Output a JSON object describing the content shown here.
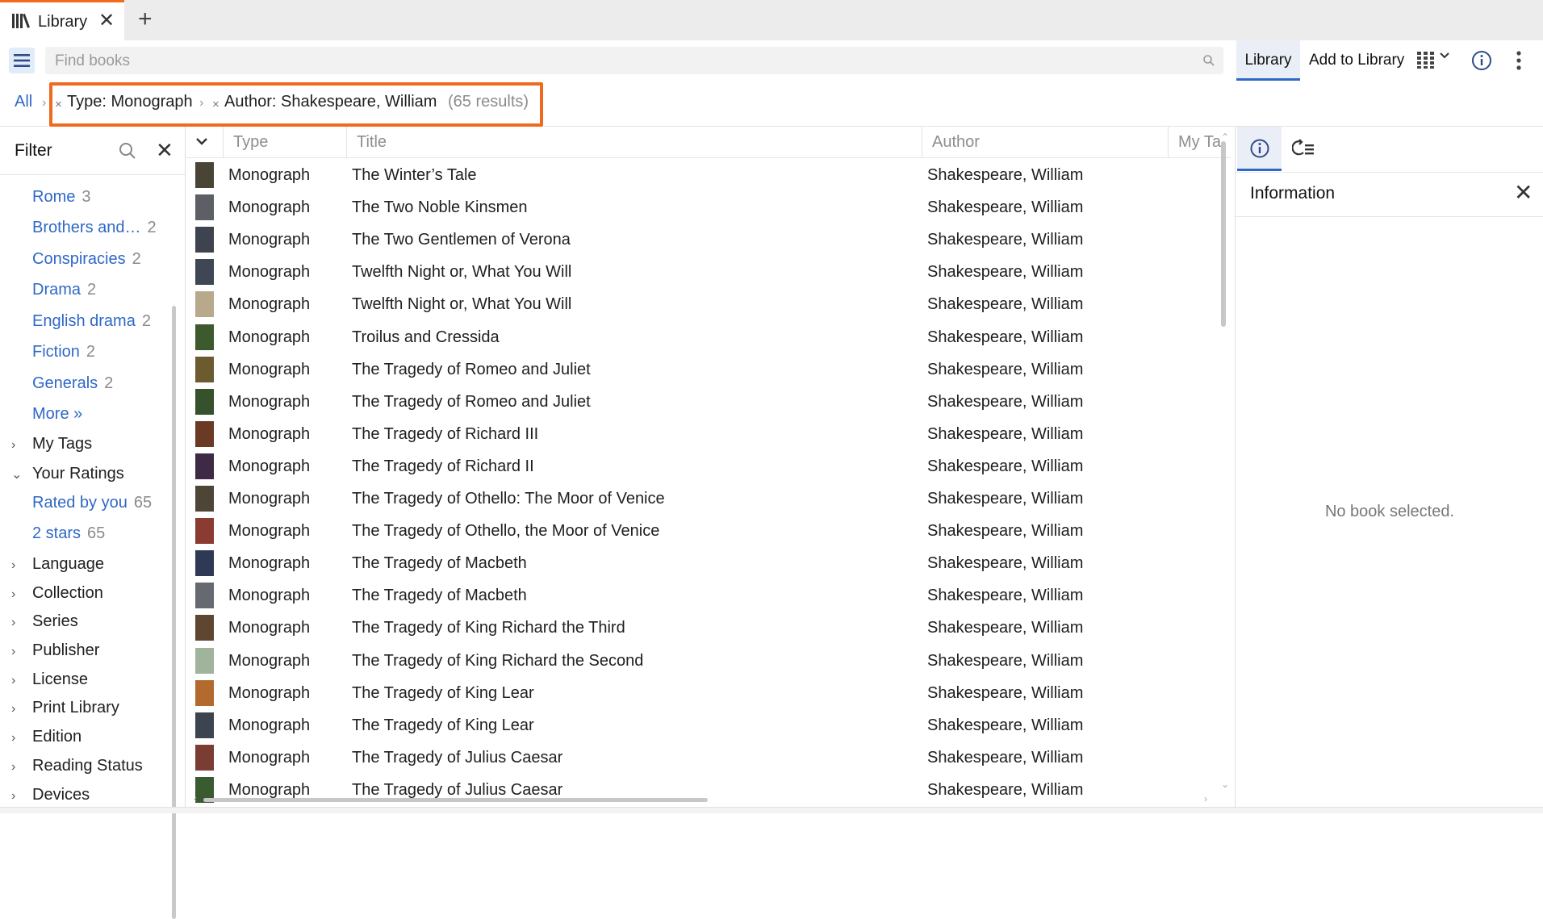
{
  "tabbar": {
    "tab_label": "Library",
    "close_icon": "close-icon",
    "new_tab_icon": "plus-icon"
  },
  "toolbar": {
    "search_placeholder": "Find books",
    "library_label": "Library",
    "add_label": "Add to Library"
  },
  "breadcrumb": {
    "all_label": "All",
    "filters": [
      {
        "label": "Type: Monograph"
      },
      {
        "label": "Author: Shakespeare, William"
      }
    ],
    "results": "(65 results)",
    "highlight_color": "#ef6a1e"
  },
  "sidebar": {
    "title": "Filter",
    "subjects": [
      {
        "label": "Rome",
        "count": "3"
      },
      {
        "label": "Brothers and…",
        "count": "2"
      },
      {
        "label": "Conspiracies",
        "count": "2"
      },
      {
        "label": "Drama",
        "count": "2"
      },
      {
        "label": "English drama",
        "count": "2"
      },
      {
        "label": "Fiction",
        "count": "2"
      },
      {
        "label": "Generals",
        "count": "2"
      }
    ],
    "more_label": "More »",
    "my_tags": "My Tags",
    "your_ratings": "Your Ratings",
    "ratings": [
      {
        "label": "Rated by you",
        "count": "65"
      },
      {
        "label": "2 stars",
        "count": "65"
      }
    ],
    "sections": [
      "Language",
      "Collection",
      "Series",
      "Publisher",
      "License",
      "Print Library",
      "Edition",
      "Reading Status",
      "Devices"
    ]
  },
  "table": {
    "columns": {
      "type": "Type",
      "title": "Title",
      "author": "Author",
      "tags": "My Ta"
    },
    "rows": [
      {
        "type": "Monograph",
        "title": "The Winter’s Tale",
        "author": "Shakespeare, William",
        "thumb": "#4a4436"
      },
      {
        "type": "Monograph",
        "title": "The Two Noble Kinsmen",
        "author": "Shakespeare, William",
        "thumb": "#5c6066"
      },
      {
        "type": "Monograph",
        "title": "The Two Gentlemen of Verona",
        "author": "Shakespeare, William",
        "thumb": "#3d4450"
      },
      {
        "type": "Monograph",
        "title": "Twelfth Night or, What You Will",
        "author": "Shakespeare, William",
        "thumb": "#3f4654"
      },
      {
        "type": "Monograph",
        "title": "Twelfth Night or, What You Will",
        "author": "Shakespeare, William",
        "thumb": "#b8a98c"
      },
      {
        "type": "Monograph",
        "title": "Troilus and Cressida",
        "author": "Shakespeare, William",
        "thumb": "#3c5a2e"
      },
      {
        "type": "Monograph",
        "title": "The Tragedy of Romeo and Juliet",
        "author": "Shakespeare, William",
        "thumb": "#6b5b2f"
      },
      {
        "type": "Monograph",
        "title": "The Tragedy of Romeo and Juliet",
        "author": "Shakespeare, William",
        "thumb": "#35522d"
      },
      {
        "type": "Monograph",
        "title": "The Tragedy of Richard III",
        "author": "Shakespeare, William",
        "thumb": "#6a3a24"
      },
      {
        "type": "Monograph",
        "title": "The Tragedy of Richard II",
        "author": "Shakespeare, William",
        "thumb": "#3e2a45"
      },
      {
        "type": "Monograph",
        "title": "The Tragedy of Othello: The Moor of Venice",
        "author": "Shakespeare, William",
        "thumb": "#4d4636"
      },
      {
        "type": "Monograph",
        "title": "The Tragedy of Othello, the Moor of Venice",
        "author": "Shakespeare, William",
        "thumb": "#8a3b32"
      },
      {
        "type": "Monograph",
        "title": "The Tragedy of Macbeth",
        "author": "Shakespeare, William",
        "thumb": "#2e3a55"
      },
      {
        "type": "Monograph",
        "title": "The Tragedy of Macbeth",
        "author": "Shakespeare, William",
        "thumb": "#656a70"
      },
      {
        "type": "Monograph",
        "title": "The Tragedy of King Richard the Third",
        "author": "Shakespeare, William",
        "thumb": "#5e4630"
      },
      {
        "type": "Monograph",
        "title": "The Tragedy of King Richard the Second",
        "author": "Shakespeare, William",
        "thumb": "#9fb49a"
      },
      {
        "type": "Monograph",
        "title": "The Tragedy of King Lear",
        "author": "Shakespeare, William",
        "thumb": "#b36a2f"
      },
      {
        "type": "Monograph",
        "title": "The Tragedy of King Lear",
        "author": "Shakespeare, William",
        "thumb": "#3c4450"
      },
      {
        "type": "Monograph",
        "title": "The Tragedy of Julius Caesar",
        "author": "Shakespeare, William",
        "thumb": "#7a3d34"
      },
      {
        "type": "Monograph",
        "title": "The Tragedy of Julius Caesar",
        "author": "Shakespeare, William",
        "thumb": "#3a5a30"
      }
    ]
  },
  "info_panel": {
    "title": "Information",
    "empty_message": "No book selected."
  },
  "colors": {
    "accent": "#2f68c7",
    "tab_accent": "#f26a1b"
  }
}
